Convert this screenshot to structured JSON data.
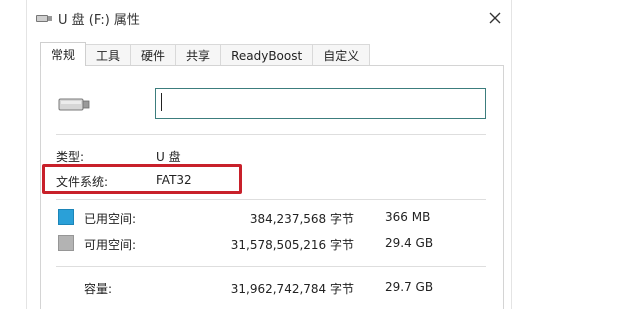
{
  "window": {
    "title": "U 盘 (F:) 属性",
    "close_icon": "close-icon"
  },
  "tabs": [
    {
      "label": "常规",
      "active": true
    },
    {
      "label": "工具",
      "active": false
    },
    {
      "label": "硬件",
      "active": false
    },
    {
      "label": "共享",
      "active": false
    },
    {
      "label": "ReadyBoost",
      "active": false
    },
    {
      "label": "自定义",
      "active": false
    }
  ],
  "general": {
    "drive_icon": "usb-drive-icon",
    "name_value": "",
    "type_label": "类型:",
    "type_value": "U 盘",
    "fs_label": "文件系统:",
    "fs_value": "FAT32"
  },
  "usage": {
    "used": {
      "label": "已用空间:",
      "bytes": "384,237,568 字节",
      "size": "366 MB",
      "color": "#2aa0d8"
    },
    "free": {
      "label": "可用空间:",
      "bytes": "31,578,505,216 字节",
      "size": "29.4 GB",
      "color": "#b3b3b3"
    },
    "capacity": {
      "label": "容量:",
      "bytes": "31,962,742,784 字节",
      "size": "29.7 GB"
    }
  },
  "colors": {
    "highlight": "#c8202a",
    "input_border": "#3c7d7d"
  }
}
